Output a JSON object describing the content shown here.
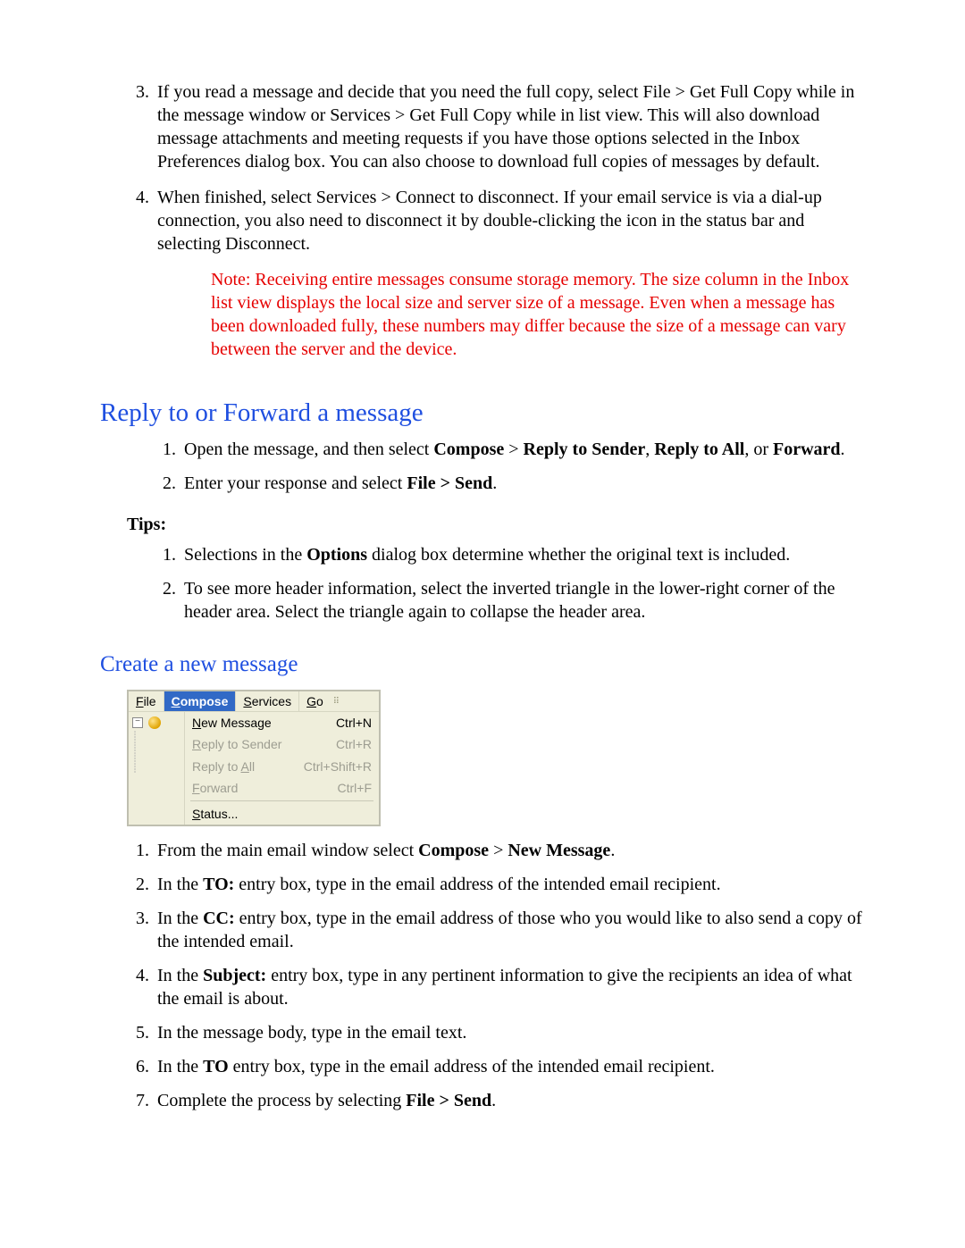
{
  "top_list": {
    "start": 3,
    "item3": "If you read a message and decide that you need the full copy, select File > Get Full Copy while in the message window or Services > Get Full Copy while in list view.  This will also download message attachments and meeting requests if you have those options selected in the Inbox Preferences dialog box. You can also choose to download full copies of messages by default.",
    "item4": "When finished, select Services > Connect to disconnect.  If your email service is via a dial-up connection, you also need to disconnect it by double-clicking the icon in the status bar and selecting Disconnect.",
    "note": "Note:  Receiving entire messages consume storage memory.  The size column in the Inbox list view displays the local size and server size of a message. Even when a message has been downloaded fully, these numbers may differ because the size of a message can vary between the server and the device."
  },
  "section1": {
    "title": "Reply to or Forward a message",
    "list": {
      "i1_pre": "Open the message, and then select ",
      "i1_b1": "Compose",
      "i1_gt": " > ",
      "i1_b2": "Reply to Sender",
      "i1_comma": ", ",
      "i1_b3": "Reply to All",
      "i1_or": ", or ",
      "i1_b4": "Forward",
      "i1_post": ".",
      "i2_pre": "Enter your response and select ",
      "i2_b1": "File > Send",
      "i2_post": "."
    },
    "tips_label": "Tips:",
    "tips": {
      "t1_pre": "Selections in the ",
      "t1_b": "Options",
      "t1_post": " dialog box determine whether the original text is included.",
      "t2": "To see more header information, select the inverted triangle in the lower-right corner of the header area. Select the triangle again to collapse the header area."
    }
  },
  "section2": {
    "title": "Create a new message",
    "menu": {
      "bar": {
        "file": "File",
        "compose": "Compose",
        "services": "Services",
        "go": "Go"
      },
      "items": {
        "new_msg": {
          "label": "New Message",
          "accel": "Ctrl+N",
          "enabled": true
        },
        "reply_sender": {
          "label": "Reply to Sender",
          "accel": "Ctrl+R",
          "enabled": false
        },
        "reply_all": {
          "label": "Reply to All",
          "accel": "Ctrl+Shift+R",
          "enabled": false
        },
        "forward": {
          "label": "Forward",
          "accel": "Ctrl+F",
          "enabled": false
        },
        "status": {
          "label": "Status...",
          "accel": "",
          "enabled": true
        }
      }
    },
    "list": {
      "i1_pre": "From the main email window select ",
      "i1_b1": "Compose",
      "i1_gt": " > ",
      "i1_b2": "New Message",
      "i1_post": ".",
      "i2_pre": "In the ",
      "i2_b": "TO:",
      "i2_post": " entry box, type in the email address of the intended email recipient.",
      "i3_pre": "In the ",
      "i3_b": "CC:",
      "i3_post": " entry box, type in the email address of those who you would like to also send a copy of the intended email.",
      "i4_pre": "In the ",
      "i4_b": "Subject:",
      "i4_post": " entry box, type in any pertinent information to give the recipients an idea of what the email is about.",
      "i5": "In the message body, type in the email text.",
      "i6_pre": "In the ",
      "i6_b": "TO",
      "i6_post": " entry box, type in the email address of the intended email recipient.",
      "i7_pre": "Complete the process by selecting ",
      "i7_b": "File > Send",
      "i7_post": "."
    }
  }
}
